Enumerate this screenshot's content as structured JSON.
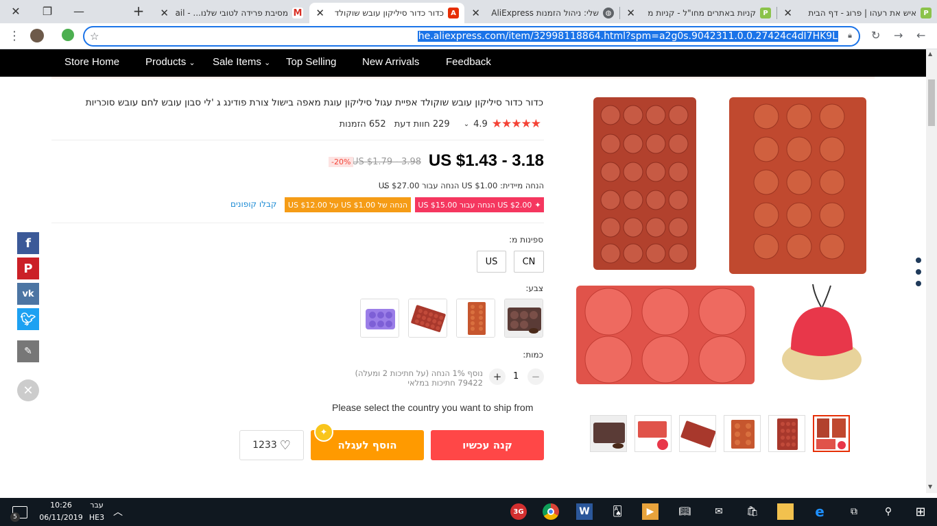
{
  "browser": {
    "tabs": [
      {
        "title": "איש את רעהו | פרוג - דף הבית",
        "favicon": "P"
      },
      {
        "title": "קניות באתרים מחו\"ל - קניות מ",
        "favicon": "P"
      },
      {
        "title": "שלי: ניהול הזמנות AliExpress",
        "favicon": "globe"
      },
      {
        "title": "כדור כדור סיליקון עובש שוקולד",
        "favicon": "A"
      },
      {
        "title": "מסיבת פרידה לטובי שלנו... - ail",
        "favicon": "M"
      }
    ],
    "url": "he.aliexpress.com/item/32998118864.html?spm=a2g0s.9042311.0.0.27424c4dI7HK9L"
  },
  "nav": {
    "items": [
      "Store Home",
      "Products",
      "Sale Items",
      "Top Selling",
      "New Arrivals",
      "Feedback"
    ]
  },
  "product": {
    "title": "כדור כדור סיליקון עובש שוקולד אפיית עגול סיליקון עוגת מאפה בישול צורת פודינג ג 'לי סבון עובש לחם עובש סוכריות",
    "rating": "4.9",
    "reviews": "229 חוות דעת",
    "orders": "652 הזמנות",
    "price": "US $1.43 - 3.18",
    "old_price": "US $1.79 - 3.98",
    "discount": "-20%",
    "instant_discount": "הנחה מיידית: US $1.00 הנחה עבור US $27.00",
    "coupon_red": "US $2.00 הנחה עבור US $15.00",
    "coupon_orange": "הנחה של US $1.00 על US $12.00",
    "get_coupons": "קבלו קופונים",
    "ships_from_label": "ספינות מ:",
    "ships_from_options": [
      "CN",
      "US"
    ],
    "color_label": "צבע:",
    "quantity_label": "כמות:",
    "quantity": "1",
    "qty_note": "נוסף 1% הנחה (על חתיכות 2 ומעלה)",
    "stock": "79422 חתיכות במלאי",
    "ship_message": "Please select the country you want to ship from",
    "buy_now": "קנה עכשיו",
    "add_to_cart": "הוסף לעגלה",
    "wishlist_count": "1233"
  },
  "taskbar": {
    "time": "10:26",
    "date": "06/11/2019",
    "lang_top": "עבר",
    "lang_bottom": "HE3",
    "notif_count": "5"
  },
  "colors": {
    "accent": "#e62e04",
    "buy": "#ff4747",
    "cart": "#ff9a00",
    "nav": "#000000"
  }
}
